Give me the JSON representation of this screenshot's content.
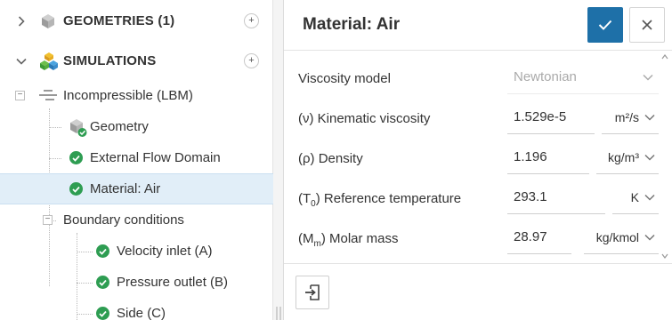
{
  "tree": {
    "geometries": {
      "label": "GEOMETRIES (1)",
      "add": "+"
    },
    "simulations": {
      "label": "SIMULATIONS",
      "add": "+"
    },
    "simulation": {
      "label": "Incompressible (LBM)",
      "toggle": "−"
    },
    "items": [
      {
        "label": "Geometry",
        "icon": "geometry-cube-icon"
      },
      {
        "label": "External Flow Domain",
        "icon": "check-icon"
      },
      {
        "label": "Material: Air",
        "icon": "check-icon",
        "selected": true
      }
    ],
    "boundary": {
      "label": "Boundary conditions",
      "toggle": "−",
      "items": [
        {
          "label": "Velocity inlet (A)"
        },
        {
          "label": "Pressure outlet (B)"
        },
        {
          "label": "Side (C)"
        }
      ]
    }
  },
  "panel": {
    "title": "Material: Air",
    "rows": [
      {
        "label_pre": "Viscosity model",
        "sub": "",
        "label_post": "",
        "value": "Newtonian",
        "unit": ""
      },
      {
        "label_pre": "(ν) Kinematic viscosity",
        "sub": "",
        "label_post": "",
        "value": "1.529e-5",
        "unit": "m²/s"
      },
      {
        "label_pre": "(ρ) Density",
        "sub": "",
        "label_post": "",
        "value": "1.196",
        "unit": "kg/m³"
      },
      {
        "label_pre": "(T",
        "sub": "0",
        "label_post": ") Reference temperature",
        "value": "293.1",
        "unit": "K"
      },
      {
        "label_pre": "(M",
        "sub": "m",
        "label_post": ") Molar mass",
        "value": "28.97",
        "unit": "kg/kmol"
      }
    ]
  },
  "colors": {
    "accent": "#1e70a8",
    "success": "#2e9d52",
    "selected_row": "#e1eef8"
  }
}
